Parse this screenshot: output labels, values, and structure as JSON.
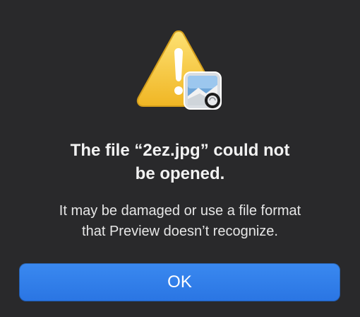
{
  "alert": {
    "title_line1": "The file “2ez.jpg” could not",
    "title_line2": "be opened.",
    "message_line1": "It may be damaged or use a file format",
    "message_line2": "that Preview doesn’t recognize.",
    "ok_label": "OK"
  },
  "icons": {
    "warning": "warning-icon",
    "app": "preview-app-icon"
  },
  "colors": {
    "background": "#29292b",
    "button_blue": "#2f7ee8",
    "warning_yellow": "#f3c53b"
  }
}
